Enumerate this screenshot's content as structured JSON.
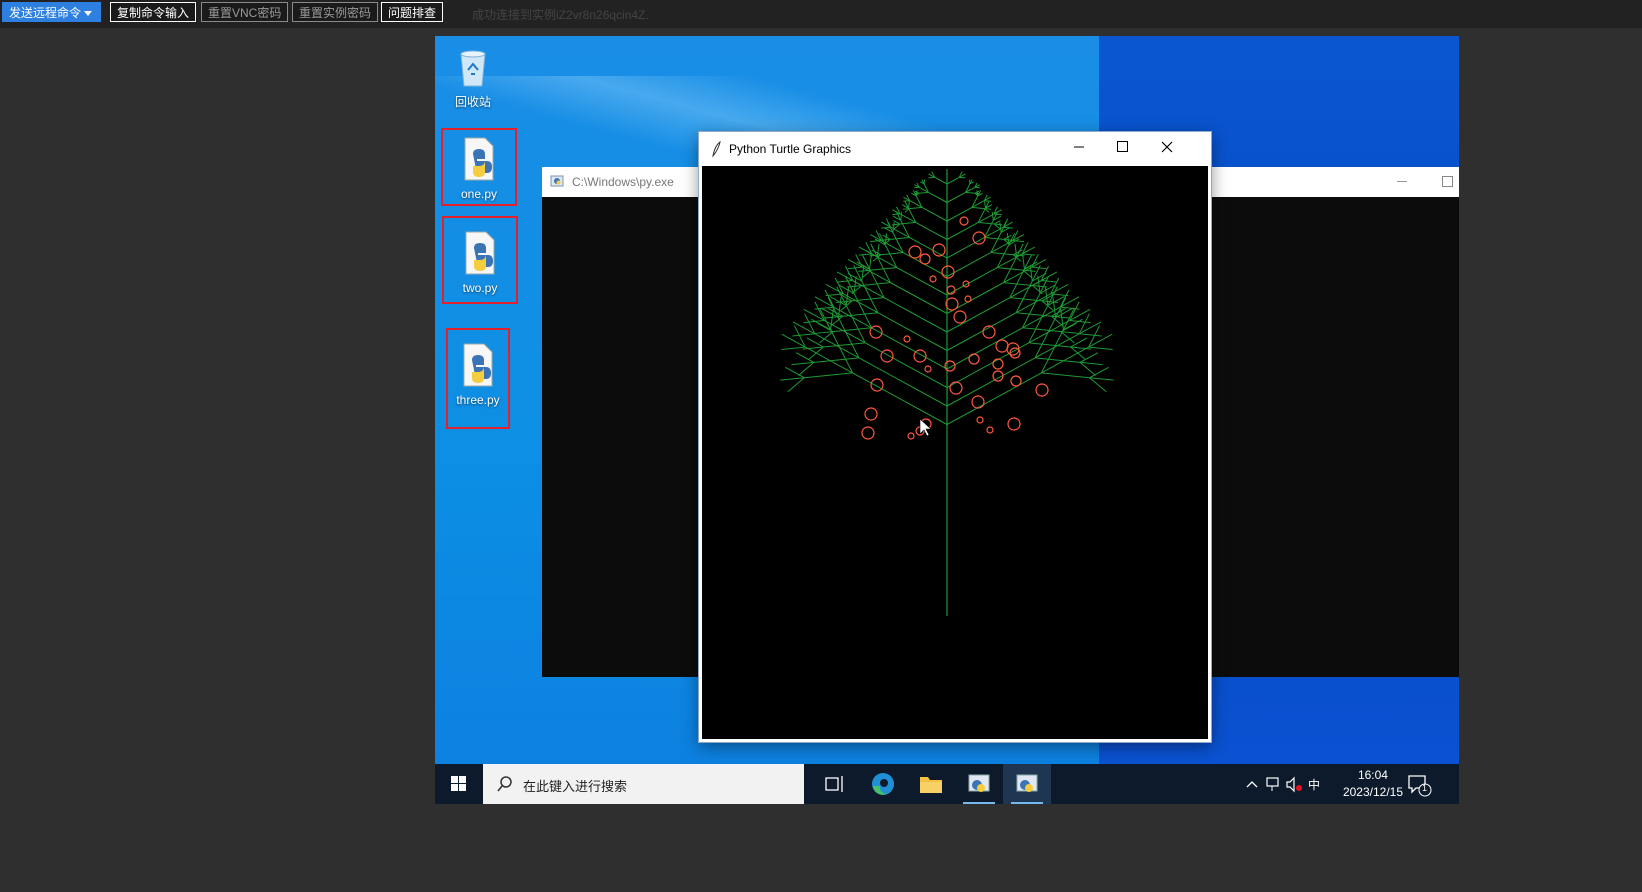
{
  "toolbar": {
    "send_command": "发送远程命令",
    "copy_input": "复制命令输入",
    "reset_vnc": "重置VNC密码",
    "reset_instance": "重置实例密码",
    "troubleshoot": "问题排查",
    "status": "成功连接到实例iZ2vr8n26qcin4Z."
  },
  "desktop": {
    "icons": [
      {
        "label": "回收站",
        "icon": "recycle-bin-icon"
      },
      {
        "label": "one.py",
        "icon": "python-file-icon"
      },
      {
        "label": "two.py",
        "icon": "python-file-icon"
      },
      {
        "label": "three.py",
        "icon": "python-file-icon"
      }
    ]
  },
  "console_window": {
    "title": "C:\\Windows\\py.exe"
  },
  "turtle_window": {
    "title": "Python Turtle Graphics"
  },
  "taskbar": {
    "search_placeholder": "在此键入进行搜索",
    "apps": [
      "task-view-icon",
      "edge-icon",
      "file-explorer-icon",
      "python-launcher-icon",
      "python-turtle-icon"
    ],
    "ime": "中",
    "time": "16:04",
    "date": "2023/12/15",
    "notification_count": "1"
  },
  "colors": {
    "accent": "#2d7fe0",
    "tree": "#1f9a33",
    "ornament": "#ff5a3c",
    "selection": "#e5202a"
  }
}
